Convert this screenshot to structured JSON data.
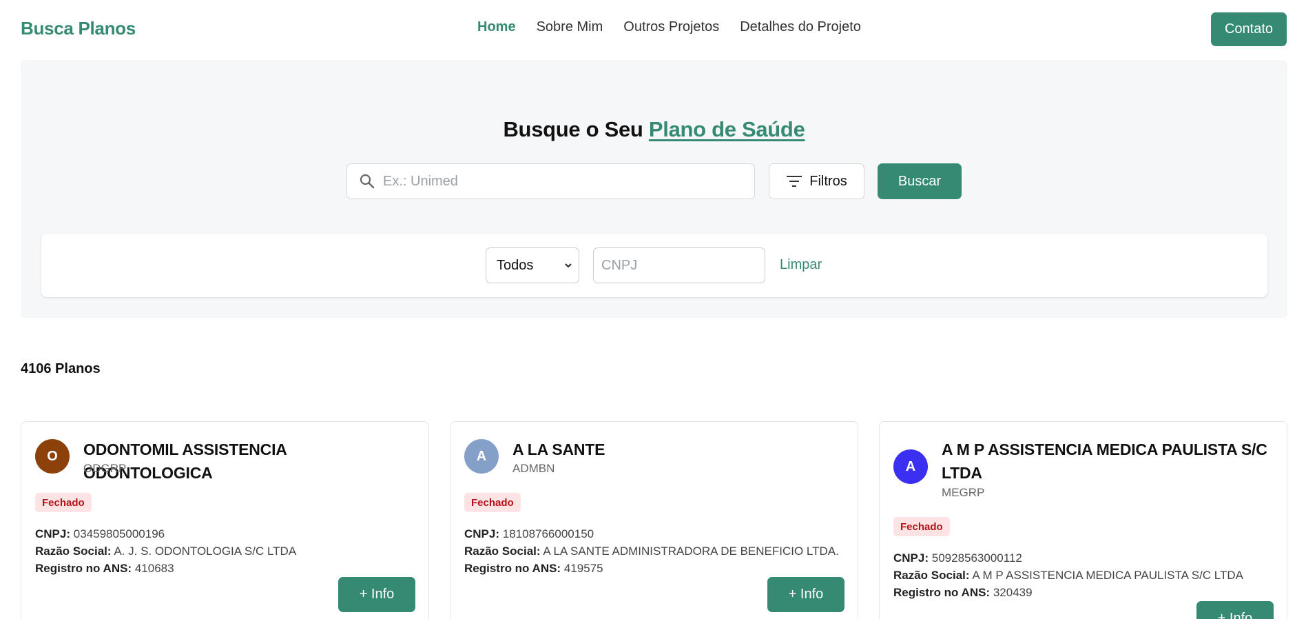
{
  "header": {
    "brand": "Busca Planos",
    "nav": [
      "Home",
      "Sobre Mim",
      "Outros Projetos",
      "Detalhes do Projeto"
    ],
    "active_nav": "Home",
    "contact_label": "Contato"
  },
  "hero": {
    "title_prefix": "Busque o Seu ",
    "title_accent": "Plano de Saúde",
    "search_placeholder": "Ex.: Unimed",
    "filters_label": "Filtros",
    "search_button": "Buscar"
  },
  "filters": {
    "type_selected": "Todos",
    "cnpj_placeholder": "CNPJ",
    "clear_label": "Limpar"
  },
  "results": {
    "count_text": "4106 Planos",
    "labels": {
      "cnpj": "CNPJ:",
      "razao": "Razão Social:",
      "registro": "Registro no ANS:"
    },
    "more_info_label": "+ Info",
    "cards": [
      {
        "initial": "O",
        "avatar_color": "#8b4109",
        "name": "ODONTOMIL ASSISTENCIA ODONTOLOGICA",
        "code": "ODGRP",
        "status": "Fechado",
        "cnpj": "03459805000196",
        "razao_social": "A. J. S. ODONTOLOGIA S/C LTDA",
        "registro_ans": "410683"
      },
      {
        "initial": "A",
        "avatar_color": "#85a0c8",
        "name": "A LA SANTE",
        "code": "ADMBN",
        "status": "Fechado",
        "cnpj": "18108766000150",
        "razao_social": "A LA SANTE ADMINISTRADORA DE BENEFICIO LTDA.",
        "registro_ans": "419575"
      },
      {
        "initial": "A",
        "avatar_color": "#3b2ff0",
        "name": "A M P ASSISTENCIA MEDICA PAULISTA S/C LTDA",
        "code": "MEGRP",
        "status": "Fechado",
        "cnpj": "50928563000112",
        "razao_social": "A M P ASSISTENCIA MEDICA PAULISTA S/C LTDA",
        "registro_ans": "320439"
      }
    ]
  },
  "colors": {
    "accent": "#358a73",
    "status_closed_bg": "#fde3e4",
    "status_closed_text": "#b4121b"
  },
  "icons": {
    "search": "search-icon",
    "filter": "filter-icon",
    "select_arrow": "chevron-down-icon"
  }
}
